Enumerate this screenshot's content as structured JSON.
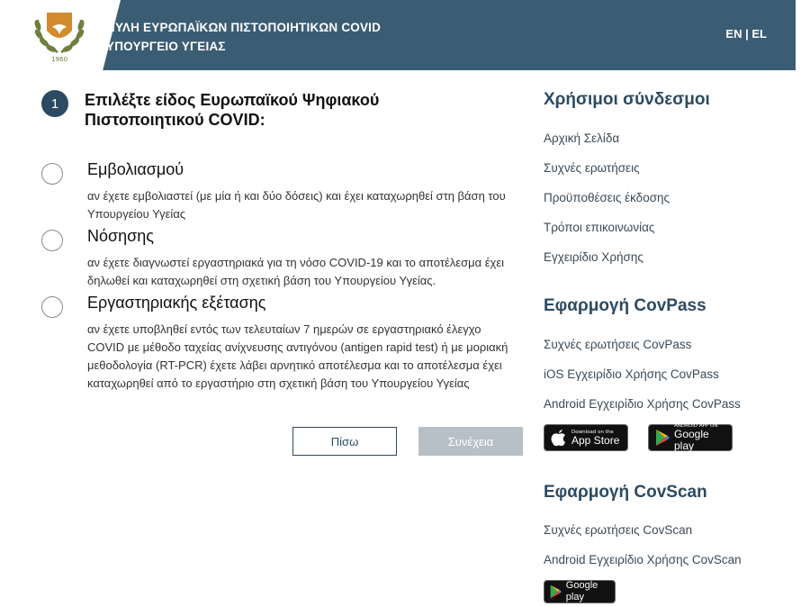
{
  "header": {
    "title_line1": "ΠΥΛΗ ΕΥΡΩΠΑΪΚΩΝ ΠΙΣΤΟΠΟΙΗΤΙΚΩΝ COVID",
    "title_line2": "ΥΠΟΥΡΓΕΙΟ ΥΓΕΙΑΣ",
    "lang_en": "EN",
    "lang_sep": "|",
    "lang_el": "EL"
  },
  "step": {
    "number": "1",
    "title": "Επιλέξτε είδος Ευρωπαϊκού Ψηφιακού Πιστοποιητικού COVID:"
  },
  "options": [
    {
      "label": "Εμβολιασμού",
      "desc": "αν έχετε εμβολιαστεί (με μία ή και δύο δόσεις) και έχει καταχωρηθεί στη βάση του Υπουργείου Υγείας"
    },
    {
      "label": "Νόσησης",
      "desc": "αν έχετε διαγνωστεί εργαστηριακά για τη νόσο COVID-19 και το αποτέλεσμα έχει δηλωθεί και καταχωρηθεί στη σχετική βάση του Υπουργείου Υγείας."
    },
    {
      "label": "Εργαστηριακής εξέτασης",
      "desc": "αν έχετε υποβληθεί εντός των τελευταίων 7 ημερών σε εργαστηριακό έλεγχο COVID με μέθοδο ταχείας ανίχνευσης αντιγόνου (antigen rapid test) ή με μοριακή μεθοδολογία (RT-PCR) έχετε λάβει αρνητικό αποτέλεσμα και το αποτέλεσμα έχει καταχωρηθεί από το εργαστήριο στη σχετική βάση του Υπουργείου Υγείας"
    }
  ],
  "buttons": {
    "back": "Πίσω",
    "next": "Συνέχεια"
  },
  "sidebar": {
    "useful_links": {
      "heading": "Χρήσιμοι σύνδεσμοι",
      "links": [
        "Αρχική Σελίδα",
        "Συχνές ερωτήσεις",
        "Προϋποθέσεις έκδοσης",
        "Τρόποι επικοινωνίας",
        "Εγχειρίδιο Χρήσης"
      ]
    },
    "covpass": {
      "heading": "Εφαρμογή CovPass",
      "links": [
        "Συχνές ερωτήσεις CovPass",
        "iOS Εγχειρίδιο Χρήσης CovPass",
        "Android Εγχειρίδιο Χρήσης CovPass"
      ]
    },
    "covscan": {
      "heading": "Εφαρμογή CovScan",
      "links": [
        "Συχνές ερωτήσεις CovScan",
        "Android Εγχειρίδιο Χρήσης CovScan"
      ]
    },
    "badges": {
      "appstore_small": "Download on the",
      "appstore_big": "App Store",
      "gplay_small": "ANDROID APP ON",
      "gplay_big": "Google play",
      "gplay2_big": "Google play"
    }
  },
  "colors": {
    "header_bg": "#3b5d73",
    "accent": "#2c4a62",
    "disabled_button": "#b7c0c7"
  }
}
